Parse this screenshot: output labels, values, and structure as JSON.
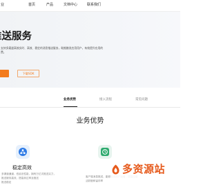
{
  "nav": {
    "brand_fragment": "业",
    "items": [
      "首页",
      "产品",
      "文档中心",
      "联系我们"
    ]
  },
  "hero": {
    "title": "推送服务",
    "description_lines": [
      "支持多渠道高效实时、高效、稳定的消息推送服务，助推触发应用用户，有效提升应用的",
      "费。"
    ],
    "primary_button_label": "",
    "secondary_button_label": "下载SDK"
  },
  "tabs": [
    {
      "label": "业务优势",
      "active": true
    },
    {
      "label": "接入流程",
      "active": false
    },
    {
      "label": "常见问题",
      "active": false
    }
  ],
  "section": {
    "title": "业务优势",
    "features": [
      {
        "icon": "cloud-network-icon",
        "title": "稳定高效",
        "description_lines": [
          "多渠道通道，低延迟性能，拥有万亿次推送实力，",
          "推送服务高效，提高到达率及推送",
          "推送稳定"
        ]
      },
      {
        "icon": "bell-clock-icon",
        "title": "",
        "description_lines": [
          "客户端消息推送，能够推送用户运营，提高应用",
          "活跃度和留存率"
        ]
      }
    ]
  },
  "watermark": {
    "text": "多资源站"
  },
  "colors": {
    "accent": "#f37b1d",
    "watermark": "#e65a1c",
    "icon_blue": "#2f7be6",
    "icon_green": "#2eaa6e"
  }
}
